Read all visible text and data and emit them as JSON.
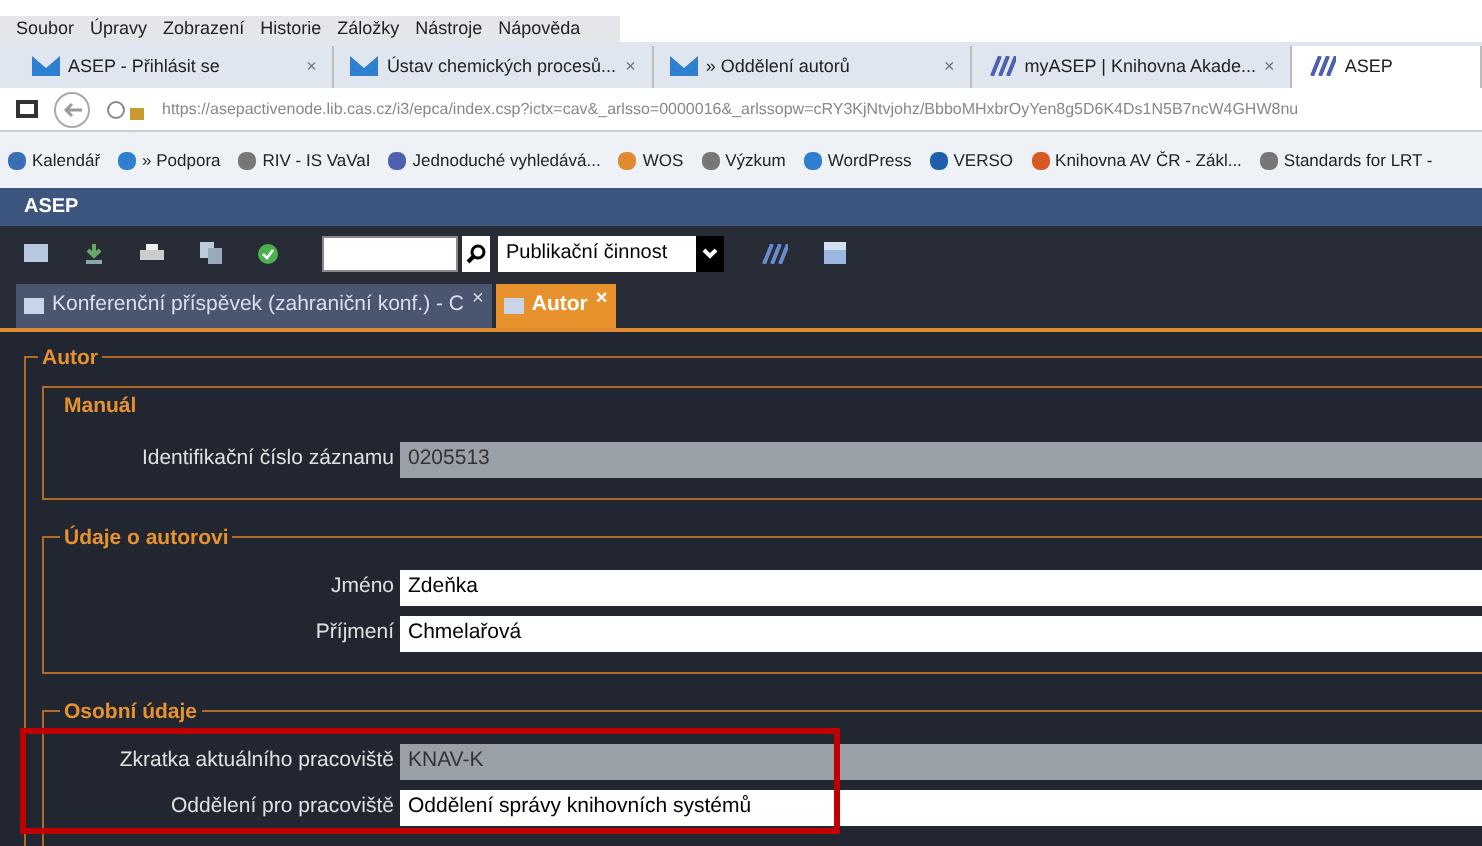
{
  "menu_bar": [
    "Soubor",
    "Úpravy",
    "Zobrazení",
    "Historie",
    "Záložky",
    "Nástroje",
    "Nápověda"
  ],
  "browser_tabs": [
    {
      "label": "ASEP - Přihlásit se",
      "selected": false,
      "kind": "mail"
    },
    {
      "label": "Ústav chemických procesů...",
      "selected": false,
      "kind": "mail"
    },
    {
      "label": "» Oddělení autorů",
      "selected": false,
      "kind": "mail"
    },
    {
      "label": "myASEP | Knihovna Akade...",
      "selected": false,
      "kind": "asep"
    },
    {
      "label": "ASEP",
      "selected": true,
      "kind": "asep"
    }
  ],
  "tab_close": "×",
  "address": "https://asepactivenode.lib.cas.cz/i3/epca/index.csp?ictx=cav&_arlsso=0000016&_arlssopw=cRY3KjNtvjohz/BbboMHxbrOyYen8g5D6K4Ds1N5B7ncW4GHW8nu",
  "bookmarks": [
    {
      "label": "Kalendář",
      "color": "#3b6fb5"
    },
    {
      "label": "» Podpora",
      "color": "#2f7fd0"
    },
    {
      "label": "RIV - IS VaVaI",
      "color": "#777777"
    },
    {
      "label": "Jednoduché vyhledává...",
      "color": "#5060b0"
    },
    {
      "label": "WOS",
      "color": "#e08a30"
    },
    {
      "label": "Výzkum",
      "color": "#777777"
    },
    {
      "label": "WordPress",
      "color": "#2f7fd0"
    },
    {
      "label": "VERSO",
      "color": "#1d5fa8"
    },
    {
      "label": "Knihovna AV ČR - Zákl...",
      "color": "#d85a20"
    },
    {
      "label": "Standards for LRT -",
      "color": "#777777"
    }
  ],
  "app_title": "ASEP",
  "toolbar": {
    "dropdown_value": "Publikační činnost"
  },
  "app_tabs": [
    {
      "label": "Konferenční příspěvek (zahraniční konf.) - C",
      "selected": false
    },
    {
      "label": "Autor",
      "selected": true
    }
  ],
  "form": {
    "legend": "Autor",
    "sections": [
      {
        "title": "Manuál",
        "fields": [
          {
            "label": "Identifikační číslo záznamu",
            "value": "0205513",
            "disabled": true
          }
        ]
      },
      {
        "title": "Údaje o autorovi",
        "fields": [
          {
            "label": "Jméno",
            "value": "Zdeňka",
            "disabled": false
          },
          {
            "label": "Příjmení",
            "value": "Chmelařová",
            "disabled": false
          }
        ]
      },
      {
        "title": "Osobní údaje",
        "fields": [
          {
            "label": "Zkratka aktuálního pracoviště",
            "value": "KNAV-K",
            "disabled": true
          },
          {
            "label": "Oddělení pro pracoviště",
            "value": "Oddělení správy knihovních systémů",
            "disabled": false
          }
        ]
      }
    ]
  }
}
